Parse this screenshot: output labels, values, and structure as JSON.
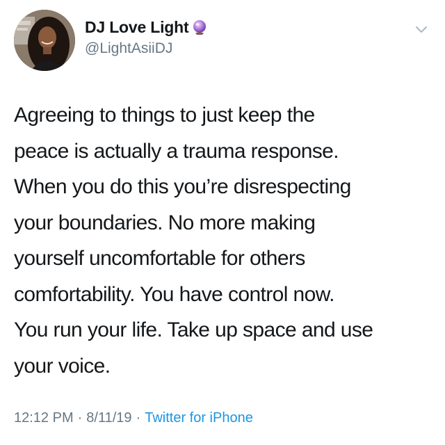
{
  "author": {
    "display_name": "DJ Love Light",
    "handle": "@LightAsiiDJ",
    "badge_icon": "crystal-ball-emoji"
  },
  "tweet": {
    "lines": [
      "Agreeing to things to just keep the",
      "peace is actually a trauma response.",
      "When you do this you’re disrespecting",
      "your boundaries. No more making",
      "yourself uncomfortable for others",
      "comfortability. You have control now.",
      "You run your life. Take up space and use",
      "your voice."
    ]
  },
  "meta": {
    "time": "12:12 PM",
    "separator": "·",
    "date": "8/11/19",
    "source": "Twitter for iPhone"
  },
  "colors": {
    "text": "#14171a",
    "secondary": "#657786",
    "link": "#1b95e0"
  }
}
